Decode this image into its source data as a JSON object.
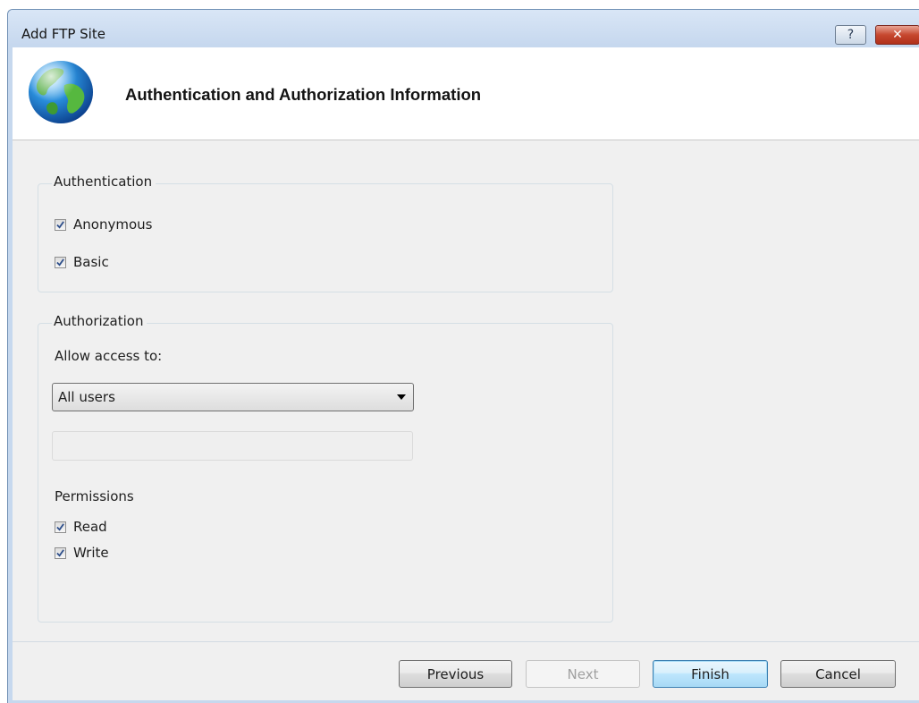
{
  "window": {
    "title": "Add FTP Site",
    "help_label": "?",
    "close_label": "✕"
  },
  "header": {
    "title": "Authentication and Authorization Information",
    "icon": "globe-icon"
  },
  "authentication": {
    "legend": "Authentication",
    "anonymous": {
      "label": "Anonymous",
      "checked": true
    },
    "basic": {
      "label": "Basic",
      "checked": true
    }
  },
  "authorization": {
    "legend": "Authorization",
    "allow_access_label": "Allow access to:",
    "allow_access_value": "All users",
    "user_field_value": "",
    "permissions_label": "Permissions",
    "read": {
      "label": "Read",
      "checked": true
    },
    "write": {
      "label": "Write",
      "checked": true
    }
  },
  "buttons": {
    "previous": "Previous",
    "next": "Next",
    "finish": "Finish",
    "cancel": "Cancel"
  },
  "colors": {
    "title_bar": "#c6d8ee",
    "close_button": "#c6472f",
    "default_button_border": "#3c7fb1"
  }
}
